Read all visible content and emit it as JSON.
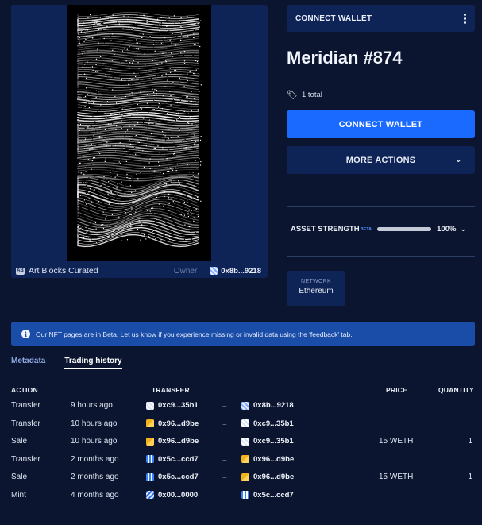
{
  "artwork": {
    "collection_name": "Art Blocks Curated",
    "owner_label": "Owner",
    "owner_address": "0x8b...9218"
  },
  "header": {
    "connect_wallet_label": "CONNECT WALLET"
  },
  "nft": {
    "title": "Meridian #874",
    "total_text": "1 total"
  },
  "actions": {
    "primary_label": "CONNECT WALLET",
    "secondary_label": "MORE ACTIONS"
  },
  "asset_strength": {
    "label": "ASSET STRENGTH",
    "badge": "BETA",
    "value_text": "100%",
    "value_fraction": 1.0
  },
  "network": {
    "label": "NETWORK",
    "value": "Ethereum"
  },
  "banner": {
    "text": "Our NFT pages are in Beta. Let us know if you experience missing or invalid data using the 'feedback' tab."
  },
  "tabs": [
    {
      "label": "Metadata",
      "active": false
    },
    {
      "label": "Trading history",
      "active": true
    }
  ],
  "table": {
    "headers": {
      "action": "ACTION",
      "transfer": "TRANSFER",
      "price": "PRICE",
      "quantity": "QUANTITY"
    },
    "rows": [
      {
        "action": "Transfer",
        "time": "9 hours ago",
        "from": "0xc9...35b1",
        "to": "0x8b...9218",
        "price": "",
        "quantity": ""
      },
      {
        "action": "Transfer",
        "time": "10 hours ago",
        "from": "0x96...d9be",
        "to": "0xc9...35b1",
        "price": "",
        "quantity": ""
      },
      {
        "action": "Sale",
        "time": "10 hours ago",
        "from": "0x96...d9be",
        "to": "0xc9...35b1",
        "price": "15 WETH",
        "quantity": "1"
      },
      {
        "action": "Transfer",
        "time": "2 months ago",
        "from": "0x5c...ccd7",
        "to": "0x96...d9be",
        "price": "",
        "quantity": ""
      },
      {
        "action": "Sale",
        "time": "2 months ago",
        "from": "0x5c...ccd7",
        "to": "0x96...d9be",
        "price": "15 WETH",
        "quantity": "1"
      },
      {
        "action": "Mint",
        "time": "4 months ago",
        "from": "0x00...0000",
        "to": "0x5c...ccd7",
        "price": "",
        "quantity": ""
      }
    ]
  }
}
